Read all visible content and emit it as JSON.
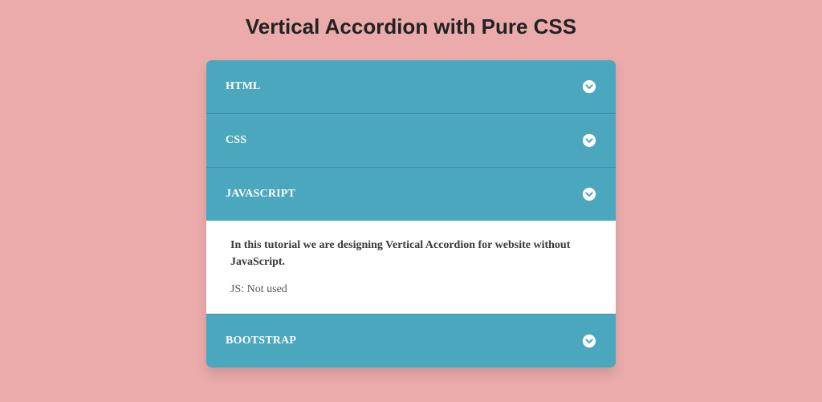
{
  "page": {
    "title": "Vertical Accordion with Pure CSS"
  },
  "accordion": {
    "items": [
      {
        "label": "HTML",
        "expanded": false
      },
      {
        "label": "CSS",
        "expanded": false
      },
      {
        "label": "JAVASCRIPT",
        "expanded": true
      },
      {
        "label": "BOOTSTRAP",
        "expanded": false
      }
    ],
    "expanded_panel": {
      "heading": "In this tutorial we are designing Vertical Accordion for website without JavaScript.",
      "detail": "JS: Not used"
    }
  }
}
